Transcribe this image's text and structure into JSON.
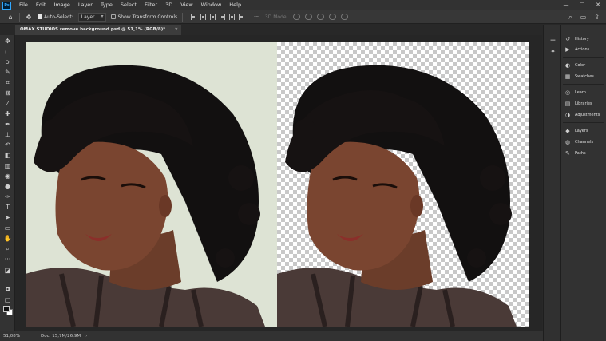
{
  "app": {
    "logo": "Ps"
  },
  "menu": [
    "File",
    "Edit",
    "Image",
    "Layer",
    "Type",
    "Select",
    "Filter",
    "3D",
    "View",
    "Window",
    "Help"
  ],
  "window_controls": {
    "minimize": "—",
    "maximize": "☐",
    "close": "✕"
  },
  "options": {
    "auto_select_label": "Auto-Select:",
    "auto_select_checked": true,
    "layer_select_value": "Layer",
    "show_transform_label": "Show Transform Controls",
    "show_transform_checked": false,
    "more_label": "···",
    "mode_3d_label": "3D Mode:"
  },
  "document": {
    "tab_title": "OMAX STUDIOS remove background.psd @ 51,1% (RGB/8)*",
    "close": "×"
  },
  "status": {
    "zoom": "51,08%",
    "doc": "Doc: 15,7M/26,9M",
    "arrow": "›"
  },
  "panels": [
    {
      "icon": "history-icon",
      "label": "History",
      "glyph": "↺"
    },
    {
      "icon": "actions-icon",
      "label": "Actions",
      "glyph": "▶"
    },
    {
      "icon": "color-icon",
      "label": "Color",
      "glyph": "◐"
    },
    {
      "icon": "swatches-icon",
      "label": "Swatches",
      "glyph": "▦"
    },
    {
      "icon": "learn-icon",
      "label": "Learn",
      "glyph": "◎"
    },
    {
      "icon": "libraries-icon",
      "label": "Libraries",
      "glyph": "▤"
    },
    {
      "icon": "adjustments-icon",
      "label": "Adjustments",
      "glyph": "◑"
    },
    {
      "icon": "layers-icon",
      "label": "Layers",
      "glyph": "◆"
    },
    {
      "icon": "channels-icon",
      "label": "Channels",
      "glyph": "◍"
    },
    {
      "icon": "paths-icon",
      "label": "Paths",
      "glyph": "✎"
    }
  ],
  "colors": {
    "accent": "#31a8ff",
    "background_left": "#dde3d4"
  }
}
